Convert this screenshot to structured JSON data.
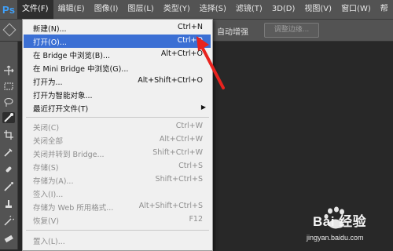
{
  "app": {
    "logo": "Ps"
  },
  "menubar": {
    "items": [
      {
        "label": "文件(F)",
        "active": true
      },
      {
        "label": "编辑(E)"
      },
      {
        "label": "图像(I)"
      },
      {
        "label": "图层(L)"
      },
      {
        "label": "类型(Y)"
      },
      {
        "label": "选择(S)"
      },
      {
        "label": "滤镜(T)"
      },
      {
        "label": "3D(D)"
      },
      {
        "label": "视图(V)"
      },
      {
        "label": "窗口(W)"
      },
      {
        "label": "帮"
      }
    ]
  },
  "options": {
    "auto_enhance": "自动增强",
    "refine_edge": "调整边缘..."
  },
  "file_menu": {
    "items": [
      {
        "label": "新建(N)...",
        "shortcut": "Ctrl+N"
      },
      {
        "label": "打开(O)...",
        "shortcut": "Ctrl+O",
        "highlighted": true
      },
      {
        "label": "在 Bridge 中浏览(B)...",
        "shortcut": "Alt+Ctrl+O"
      },
      {
        "label": "在 Mini Bridge 中浏览(G)...",
        "shortcut": ""
      },
      {
        "label": "打开为...",
        "shortcut": "Alt+Shift+Ctrl+O"
      },
      {
        "label": "打开为智能对象...",
        "shortcut": ""
      },
      {
        "label": "最近打开文件(T)",
        "shortcut": "",
        "submenu": true
      },
      {
        "label": "关闭(C)",
        "shortcut": "Ctrl+W",
        "disabled": true
      },
      {
        "label": "关闭全部",
        "shortcut": "Alt+Ctrl+W",
        "disabled": true
      },
      {
        "label": "关闭并转到 Bridge...",
        "shortcut": "Shift+Ctrl+W",
        "disabled": true
      },
      {
        "label": "存储(S)",
        "shortcut": "Ctrl+S",
        "disabled": true
      },
      {
        "label": "存储为(A)...",
        "shortcut": "Shift+Ctrl+S",
        "disabled": true
      },
      {
        "label": "签入(I)...",
        "shortcut": "",
        "disabled": true
      },
      {
        "label": "存储为 Web 所用格式...",
        "shortcut": "Alt+Shift+Ctrl+S",
        "disabled": true
      },
      {
        "label": "恢复(V)",
        "shortcut": "F12",
        "disabled": true
      },
      {
        "label": "置入(L)...",
        "shortcut": "",
        "disabled": true
      }
    ]
  },
  "watermark": {
    "text": "Bai 经验",
    "url": "jingyan.baidu.com"
  },
  "colors": {
    "highlight": "#3b6fd4",
    "annotation": "#e8231e",
    "logo": "#3fa3ff"
  }
}
